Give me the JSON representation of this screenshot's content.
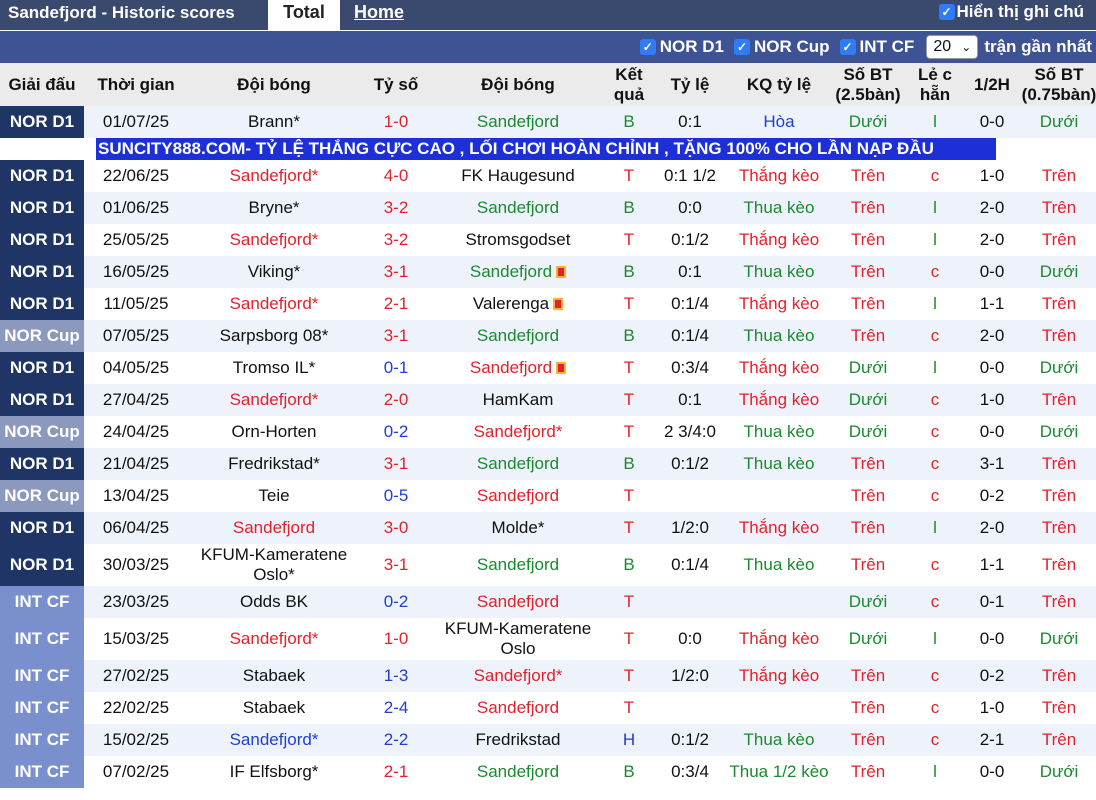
{
  "header": {
    "title": "Sandefjord - Historic scores",
    "tabs": [
      "Total",
      "Home"
    ],
    "show_notes_label": "Hiển thị ghi chú"
  },
  "filters": {
    "items": [
      "NOR D1",
      "NOR Cup",
      "INT CF"
    ],
    "count_value": "20",
    "recent_label": "trận gần nhất"
  },
  "columns": [
    "Giải đấu",
    "Thời gian",
    "Đội bóng",
    "Tỷ số",
    "Đội bóng",
    "Kết quả",
    "Tỷ lệ",
    "KQ tỷ lệ",
    "Số BT (2.5bàn)",
    "Lẻ c hẵn",
    "1/2H",
    "Số BT (0.75bàn)"
  ],
  "ad_text": "SUNCITY888.COM- TỶ LỆ THẮNG CỰC CAO , LỐI CHƠI HOÀN CHỈNH , TẶNG 100% CHO LẦN NẠP ĐẦU",
  "rows": [
    {
      "league": "NOR D1",
      "lt": "nor",
      "date": "01/07/25",
      "home": "Brann*",
      "hc": "dark",
      "score": "1-0",
      "away": "Sandefjord",
      "ac": "green",
      "res": "B",
      "odds": "0:1",
      "kq": "Hòa",
      "ou": "Dưới",
      "oe": "l",
      "half": "0-0",
      "ou2": "Dưới"
    },
    {
      "league": "NOR D1",
      "lt": "nor",
      "date": "22/06/25",
      "home": "Sandefjord*",
      "hc": "red",
      "score": "4-0",
      "away": "FK Haugesund",
      "ac": "dark",
      "res": "T",
      "odds": "0:1 1/2",
      "kq": "Thắng kèo",
      "ou": "Trên",
      "oe": "c",
      "half": "1-0",
      "ou2": "Trên"
    },
    {
      "league": "NOR D1",
      "lt": "nor",
      "date": "01/06/25",
      "home": "Bryne*",
      "hc": "dark",
      "score": "3-2",
      "away": "Sandefjord",
      "ac": "green",
      "res": "B",
      "odds": "0:0",
      "kq": "Thua kèo",
      "ou": "Trên",
      "oe": "l",
      "half": "2-0",
      "ou2": "Trên"
    },
    {
      "league": "NOR D1",
      "lt": "nor",
      "date": "25/05/25",
      "home": "Sandefjord*",
      "hc": "red",
      "score": "3-2",
      "away": "Stromsgodset",
      "ac": "dark",
      "res": "T",
      "odds": "0:1/2",
      "kq": "Thắng kèo",
      "ou": "Trên",
      "oe": "l",
      "half": "2-0",
      "ou2": "Trên"
    },
    {
      "league": "NOR D1",
      "lt": "nor",
      "date": "16/05/25",
      "home": "Viking*",
      "hc": "dark",
      "score": "3-1",
      "away": "Sandefjord",
      "ac": "green",
      "flag": true,
      "res": "B",
      "odds": "0:1",
      "kq": "Thua kèo",
      "ou": "Trên",
      "oe": "c",
      "half": "0-0",
      "ou2": "Dưới"
    },
    {
      "league": "NOR D1",
      "lt": "nor",
      "date": "11/05/25",
      "home": "Sandefjord*",
      "hc": "red",
      "score": "2-1",
      "away": "Valerenga",
      "ac": "dark",
      "flag": true,
      "res": "T",
      "odds": "0:1/4",
      "kq": "Thắng kèo",
      "ou": "Trên",
      "oe": "l",
      "half": "1-1",
      "ou2": "Trên"
    },
    {
      "league": "NOR Cup",
      "lt": "cup",
      "date": "07/05/25",
      "home": "Sarpsborg 08*",
      "hc": "dark",
      "score": "3-1",
      "away": "Sandefjord",
      "ac": "green",
      "res": "B",
      "odds": "0:1/4",
      "kq": "Thua kèo",
      "ou": "Trên",
      "oe": "c",
      "half": "2-0",
      "ou2": "Trên"
    },
    {
      "league": "NOR D1",
      "lt": "nor",
      "date": "04/05/25",
      "home": "Tromso IL*",
      "hc": "dark",
      "score": "0-1",
      "away": "Sandefjord",
      "ac": "red",
      "flag": true,
      "res": "T",
      "odds": "0:3/4",
      "kq": "Thắng kèo",
      "ou": "Dưới",
      "oe": "l",
      "half": "0-0",
      "ou2": "Dưới"
    },
    {
      "league": "NOR D1",
      "lt": "nor",
      "date": "27/04/25",
      "home": "Sandefjord*",
      "hc": "red",
      "score": "2-0",
      "away": "HamKam",
      "ac": "dark",
      "res": "T",
      "odds": "0:1",
      "kq": "Thắng kèo",
      "ou": "Dưới",
      "oe": "c",
      "half": "1-0",
      "ou2": "Trên"
    },
    {
      "league": "NOR Cup",
      "lt": "cup",
      "date": "24/04/25",
      "home": "Orn-Horten",
      "hc": "dark",
      "score": "0-2",
      "away": "Sandefjord*",
      "ac": "red",
      "res": "T",
      "odds": "2 3/4:0",
      "kq": "Thua kèo",
      "ou": "Dưới",
      "oe": "c",
      "half": "0-0",
      "ou2": "Dưới"
    },
    {
      "league": "NOR D1",
      "lt": "nor",
      "date": "21/04/25",
      "home": "Fredrikstad*",
      "hc": "dark",
      "score": "3-1",
      "away": "Sandefjord",
      "ac": "green",
      "res": "B",
      "odds": "0:1/2",
      "kq": "Thua kèo",
      "ou": "Trên",
      "oe": "c",
      "half": "3-1",
      "ou2": "Trên"
    },
    {
      "league": "NOR Cup",
      "lt": "cup",
      "date": "13/04/25",
      "home": "Teie",
      "hc": "dark",
      "score": "0-5",
      "away": "Sandefjord",
      "ac": "red",
      "res": "T",
      "odds": "",
      "kq": "",
      "ou": "Trên",
      "oe": "c",
      "half": "0-2",
      "ou2": "Trên"
    },
    {
      "league": "NOR D1",
      "lt": "nor",
      "date": "06/04/25",
      "home": "Sandefjord",
      "hc": "red",
      "score": "3-0",
      "away": "Molde*",
      "ac": "dark",
      "res": "T",
      "odds": "1/2:0",
      "kq": "Thắng kèo",
      "ou": "Trên",
      "oe": "l",
      "half": "2-0",
      "ou2": "Trên"
    },
    {
      "league": "NOR D1",
      "lt": "nor",
      "date": "30/03/25",
      "home": "KFUM-Kameratene Oslo*",
      "hc": "dark",
      "tall": true,
      "score": "3-1",
      "away": "Sandefjord",
      "ac": "green",
      "res": "B",
      "odds": "0:1/4",
      "kq": "Thua kèo",
      "ou": "Trên",
      "oe": "c",
      "half": "1-1",
      "ou2": "Trên"
    },
    {
      "league": "INT CF",
      "lt": "int",
      "date": "23/03/25",
      "home": "Odds BK",
      "hc": "dark",
      "score": "0-2",
      "away": "Sandefjord",
      "ac": "red",
      "res": "T",
      "odds": "",
      "kq": "",
      "ou": "Dưới",
      "oe": "c",
      "half": "0-1",
      "ou2": "Trên"
    },
    {
      "league": "INT CF",
      "lt": "int",
      "date": "15/03/25",
      "home": "Sandefjord*",
      "hc": "red",
      "score": "1-0",
      "away": "KFUM-Kameratene Oslo",
      "ac": "dark",
      "tall": true,
      "res": "T",
      "odds": "0:0",
      "kq": "Thắng kèo",
      "ou": "Dưới",
      "oe": "l",
      "half": "0-0",
      "ou2": "Dưới"
    },
    {
      "league": "INT CF",
      "lt": "int",
      "date": "27/02/25",
      "home": "Stabaek",
      "hc": "dark",
      "score": "1-3",
      "away": "Sandefjord*",
      "ac": "red",
      "res": "T",
      "odds": "1/2:0",
      "kq": "Thắng kèo",
      "ou": "Trên",
      "oe": "c",
      "half": "0-2",
      "ou2": "Trên"
    },
    {
      "league": "INT CF",
      "lt": "int",
      "date": "22/02/25",
      "home": "Stabaek",
      "hc": "dark",
      "score": "2-4",
      "away": "Sandefjord",
      "ac": "red",
      "res": "T",
      "odds": "",
      "kq": "",
      "ou": "Trên",
      "oe": "c",
      "half": "1-0",
      "ou2": "Trên"
    },
    {
      "league": "INT CF",
      "lt": "int",
      "date": "15/02/25",
      "home": "Sandefjord*",
      "hc": "blue",
      "score": "2-2",
      "away": "Fredrikstad",
      "ac": "dark",
      "res": "H",
      "odds": "0:1/2",
      "kq": "Thua kèo",
      "ou": "Trên",
      "oe": "c",
      "half": "2-1",
      "ou2": "Trên"
    },
    {
      "league": "INT CF",
      "lt": "int",
      "date": "07/02/25",
      "home": "IF Elfsborg*",
      "hc": "dark",
      "score": "2-1",
      "away": "Sandefjord",
      "ac": "green",
      "res": "B",
      "odds": "0:3/4",
      "kq": "Thua 1/2 kèo",
      "ou": "Trên",
      "oe": "l",
      "half": "0-0",
      "ou2": "Dưới"
    }
  ]
}
